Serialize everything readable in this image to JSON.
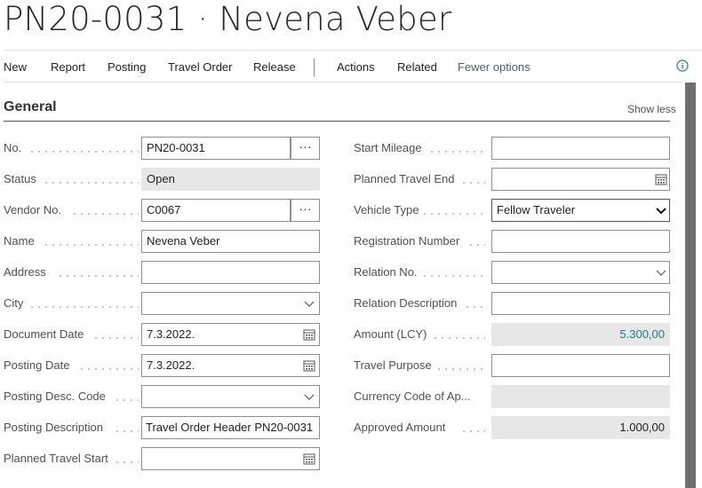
{
  "page_title": "PN20-0031 · Nevena Veber",
  "actions": [
    "New",
    "Report",
    "Posting",
    "Travel Order",
    "Release",
    "Actions",
    "Related",
    "Fewer options"
  ],
  "section": {
    "title": "General",
    "show_less": "Show less"
  },
  "left_fields": {
    "no": {
      "label": "No.",
      "value": "PN20-0031"
    },
    "status": {
      "label": "Status",
      "value": "Open"
    },
    "vendor_no": {
      "label": "Vendor No.",
      "value": "C0067"
    },
    "name": {
      "label": "Name",
      "value": "Nevena Veber"
    },
    "address": {
      "label": "Address",
      "value": ""
    },
    "city": {
      "label": "City",
      "value": ""
    },
    "document_date": {
      "label": "Document Date",
      "value": "7.3.2022."
    },
    "posting_date": {
      "label": "Posting Date",
      "value": "7.3.2022."
    },
    "posting_desc_code": {
      "label": "Posting Desc. Code",
      "value": ""
    },
    "posting_description": {
      "label": "Posting Description",
      "value": "Travel Order Header PN20-0031"
    },
    "planned_travel_start": {
      "label": "Planned Travel Start",
      "value": ""
    }
  },
  "right_fields": {
    "start_mileage": {
      "label": "Start Mileage",
      "value": ""
    },
    "planned_travel_end": {
      "label": "Planned Travel End",
      "value": ""
    },
    "vehicle_type": {
      "label": "Vehicle Type",
      "value": "Fellow Traveler"
    },
    "registration_number": {
      "label": "Registration Number",
      "value": ""
    },
    "relation_no": {
      "label": "Relation No.",
      "value": ""
    },
    "relation_description": {
      "label": "Relation Description",
      "value": ""
    },
    "amount_lcy": {
      "label": "Amount (LCY)",
      "value": "5.300,00"
    },
    "travel_purpose": {
      "label": "Travel Purpose",
      "value": ""
    },
    "currency_code": {
      "label": "Currency Code of Ap...",
      "value": ""
    },
    "approved_amount": {
      "label": "Approved Amount",
      "value": "1.000,00"
    }
  },
  "lookup_glyph": "···",
  "colors": {
    "link_value": "#1f7a8c",
    "readonly_bg": "#e7e7e7",
    "scrollbar": "#6f6f6f"
  }
}
